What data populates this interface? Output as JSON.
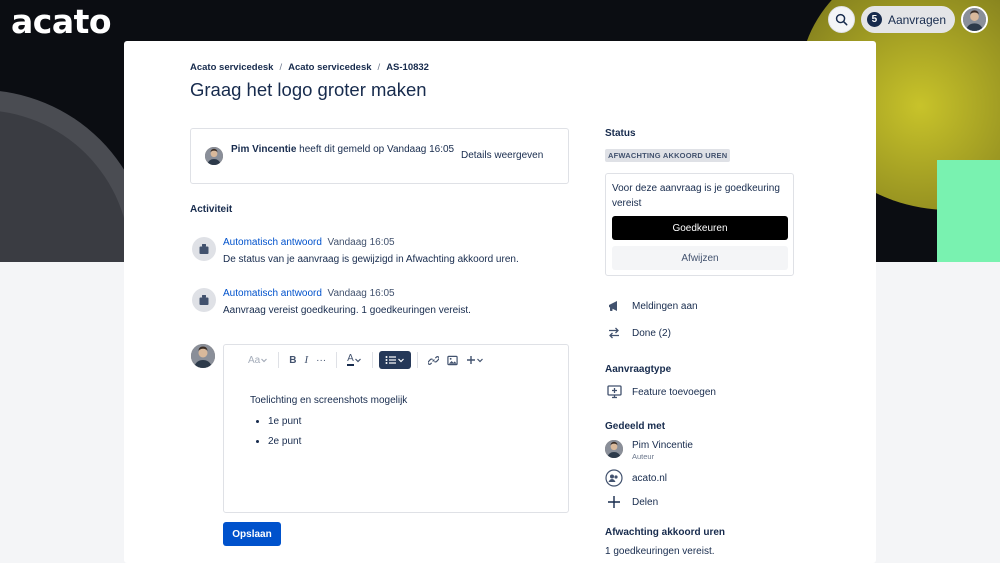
{
  "header": {
    "logo": "acato",
    "requests_count": "5",
    "requests_label": "Aanvragen",
    "search_icon": "search-icon",
    "avatar_icon": "user-avatar"
  },
  "breadcrumb": [
    "Acato servicedesk",
    "Acato servicedesk",
    "AS-10832"
  ],
  "breadcrumb_sep": "/",
  "title": "Graag het logo groter maken",
  "reporter": {
    "name": "Pim Vincentie",
    "text": " heeft dit gemeld op Vandaag 16:05",
    "details_label": "Details weergeven"
  },
  "activity": {
    "label": "Activiteit",
    "items": [
      {
        "name": "Automatisch antwoord",
        "time": "Vandaag 16:05",
        "message": "De status van je aanvraag is gewijzigd in Afwachting akkoord uren."
      },
      {
        "name": "Automatisch antwoord",
        "time": "Vandaag 16:05",
        "message": "Aanvraag vereist goedkeuring. 1 goedkeuringen vereist."
      }
    ]
  },
  "editor": {
    "toolbar": {
      "text_style": "Aa",
      "bold": "B",
      "italic": "I",
      "more": "···",
      "color": "A"
    },
    "body_text": "Toelichting en screenshots mogelijk",
    "bullets": [
      "1e punt",
      "2e punt"
    ],
    "save_label": "Opslaan"
  },
  "sidebar": {
    "status_label": "Status",
    "status_value": "AFWACHTING AKKOORD UREN",
    "approval_text": "Voor deze aanvraag is je goedkeuring vereist",
    "approve_label": "Goedkeuren",
    "reject_label": "Afwijzen",
    "notifications_label": "Meldingen aan",
    "done_label": "Done (2)",
    "request_type_label": "Aanvraagtype",
    "request_type_value": "Feature toevoegen",
    "shared_label": "Gedeeld met",
    "shared_person": "Pim Vincentie",
    "shared_person_role": "Auteur",
    "shared_org": "acato.nl",
    "share_label": "Delen",
    "waiting_label": "Afwachting akkoord uren",
    "waiting_text": "1 goedkeuringen vereist."
  }
}
